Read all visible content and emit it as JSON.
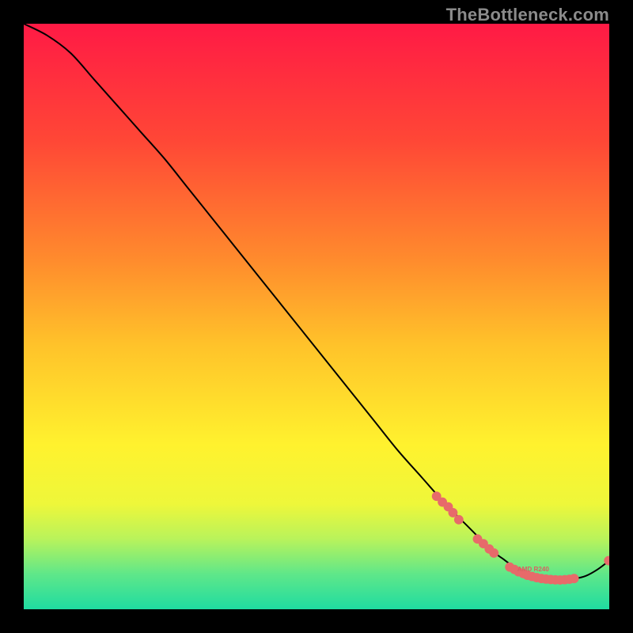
{
  "watermark": "TheBottleneck.com",
  "chart_data": {
    "type": "line",
    "title": "",
    "xlabel": "",
    "ylabel": "",
    "xlim": [
      0,
      100
    ],
    "ylim": [
      0,
      100
    ],
    "grid": false,
    "legend": false,
    "background_gradient": {
      "direction": "vertical",
      "stops": [
        {
          "pos": 0.0,
          "color": "#ff1a45"
        },
        {
          "pos": 0.2,
          "color": "#ff4736"
        },
        {
          "pos": 0.4,
          "color": "#ff8a2d"
        },
        {
          "pos": 0.55,
          "color": "#ffc32a"
        },
        {
          "pos": 0.72,
          "color": "#fff22e"
        },
        {
          "pos": 0.82,
          "color": "#eef73a"
        },
        {
          "pos": 0.88,
          "color": "#b9f35b"
        },
        {
          "pos": 0.94,
          "color": "#5fe789"
        },
        {
          "pos": 1.0,
          "color": "#1fdca1"
        }
      ]
    },
    "series": [
      {
        "name": "bottleneck-curve",
        "color": "#000000",
        "x": [
          0,
          4,
          8,
          12,
          16,
          20,
          24,
          28,
          32,
          36,
          40,
          44,
          48,
          52,
          56,
          60,
          64,
          68,
          72,
          76,
          80,
          82,
          84,
          86,
          88,
          90,
          92,
          94,
          96,
          98,
          100
        ],
        "y": [
          100,
          98,
          95,
          90.5,
          86,
          81.5,
          77,
          72,
          67,
          62,
          57,
          52,
          47,
          42,
          37,
          32,
          27,
          22.5,
          18,
          14,
          10,
          8.5,
          7,
          6,
          5.3,
          5,
          5,
          5.2,
          5.7,
          6.8,
          8.3
        ]
      }
    ],
    "markers": {
      "name": "highlight-dots",
      "color": "#e76a6a",
      "radius_plot": 0.8,
      "points": [
        {
          "x": 70.5,
          "y": 19.3
        },
        {
          "x": 71.5,
          "y": 18.3
        },
        {
          "x": 72.5,
          "y": 17.5
        },
        {
          "x": 73.3,
          "y": 16.5
        },
        {
          "x": 74.3,
          "y": 15.3
        },
        {
          "x": 77.5,
          "y": 12.0
        },
        {
          "x": 78.5,
          "y": 11.2
        },
        {
          "x": 79.5,
          "y": 10.3
        },
        {
          "x": 80.3,
          "y": 9.6
        },
        {
          "x": 83.0,
          "y": 7.2
        },
        {
          "x": 83.8,
          "y": 6.8
        },
        {
          "x": 84.5,
          "y": 6.4
        },
        {
          "x": 85.3,
          "y": 6.1
        },
        {
          "x": 86.0,
          "y": 5.8
        },
        {
          "x": 86.8,
          "y": 5.6
        },
        {
          "x": 87.6,
          "y": 5.4
        },
        {
          "x": 88.4,
          "y": 5.25
        },
        {
          "x": 89.2,
          "y": 5.15
        },
        {
          "x": 90.0,
          "y": 5.08
        },
        {
          "x": 90.8,
          "y": 5.02
        },
        {
          "x": 91.6,
          "y": 5.0
        },
        {
          "x": 92.4,
          "y": 5.05
        },
        {
          "x": 93.2,
          "y": 5.12
        },
        {
          "x": 94.0,
          "y": 5.25
        },
        {
          "x": 99.9,
          "y": 8.3
        }
      ]
    },
    "inline_label": {
      "text": "AMD R240",
      "x": 87,
      "y": 6.8,
      "color": "#d86262",
      "font_size_plot": 1.1
    }
  }
}
